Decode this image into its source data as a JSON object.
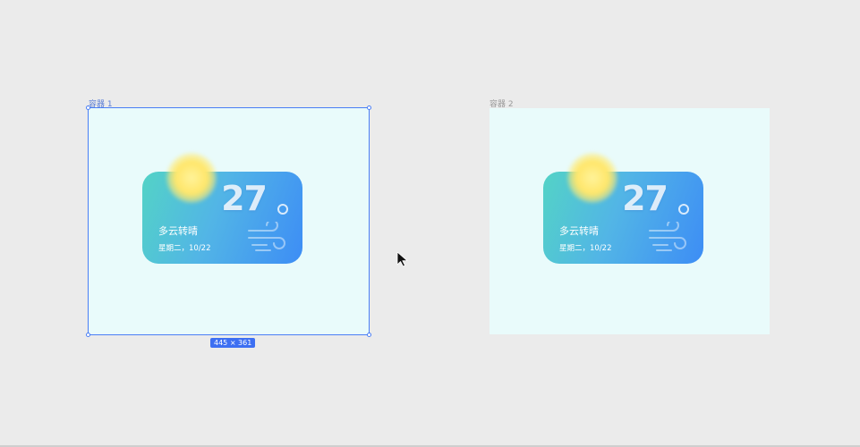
{
  "frames": [
    {
      "label": "容器 1",
      "selected": true,
      "size_badge": "445 × 361",
      "widget": {
        "temperature": "27",
        "degree_icon": "degree-circle-icon",
        "condition": "多云转晴",
        "date": "星期二，10/22",
        "weather_icon": "sun-icon",
        "wind_icon": "wind-icon"
      }
    },
    {
      "label": "容器 2",
      "selected": false,
      "widget": {
        "temperature": "27",
        "degree_icon": "degree-circle-icon",
        "condition": "多云转晴",
        "date": "星期二，10/22",
        "weather_icon": "sun-icon",
        "wind_icon": "wind-icon"
      }
    }
  ],
  "colors": {
    "canvas": "#ebebeb",
    "frame_fill": "#e9fbfb",
    "selection": "#4a7ef5",
    "card_gradient_start": "#53d3c6",
    "card_gradient_end": "#3d8df5",
    "sun": "#ffe66a"
  },
  "cursor": "arrow-cursor-icon"
}
